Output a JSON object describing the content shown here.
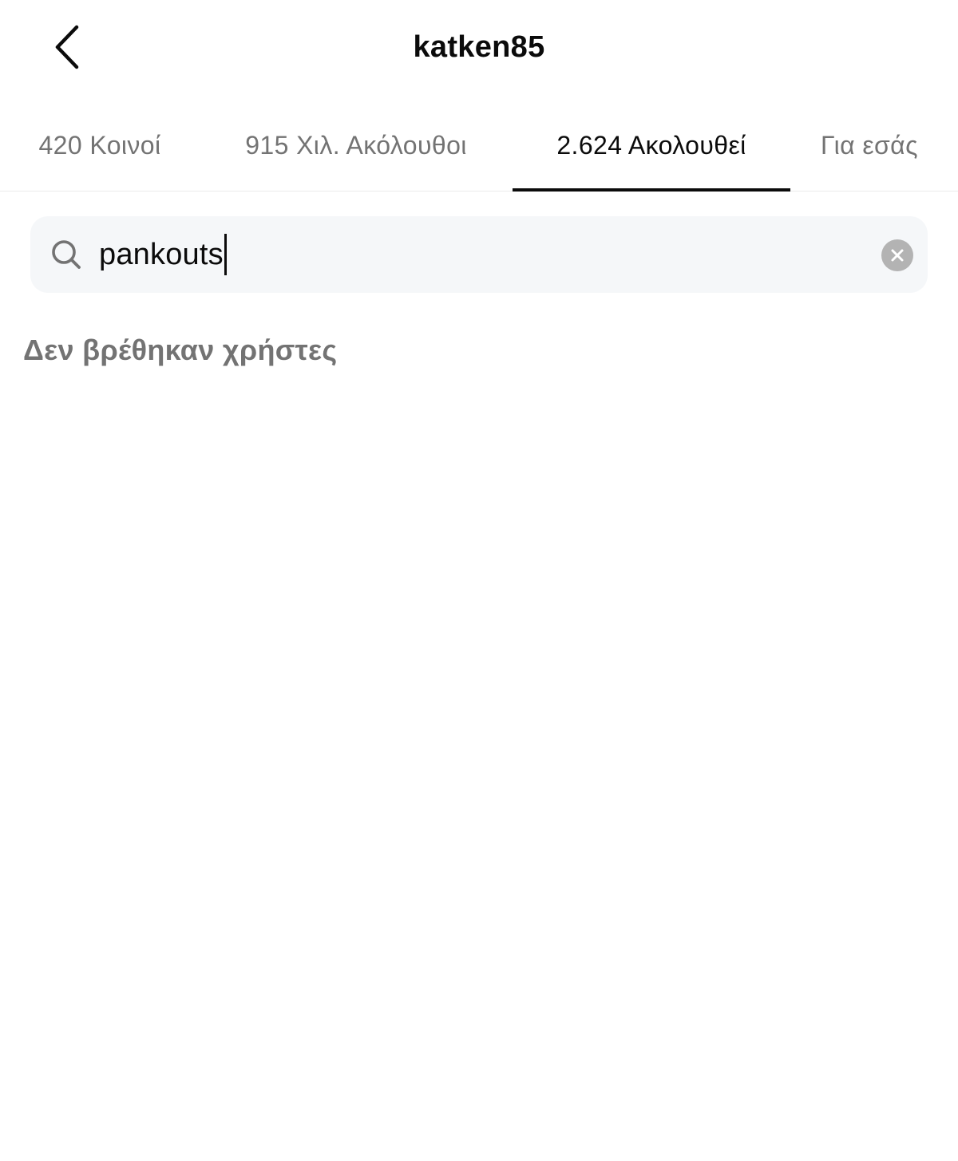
{
  "header": {
    "title": "katken85",
    "back_icon": "chevron-left-icon"
  },
  "tabs": [
    {
      "label": "420 Κοινοί",
      "active": false
    },
    {
      "label": "915 Χιλ. Ακόλουθοι",
      "active": false
    },
    {
      "label": "2.624 Ακολουθεί",
      "active": true
    },
    {
      "label": "Για εσάς",
      "active": false
    }
  ],
  "search": {
    "value": "pankouts",
    "icon": "search-icon",
    "clear_icon": "clear-icon"
  },
  "results": {
    "empty_message": "Δεν βρέθηκαν χρήστες"
  },
  "colors": {
    "text_primary": "#0b0b0b",
    "text_secondary": "#737373",
    "search_background": "#f5f7f9",
    "clear_button": "#b3b3b3"
  }
}
